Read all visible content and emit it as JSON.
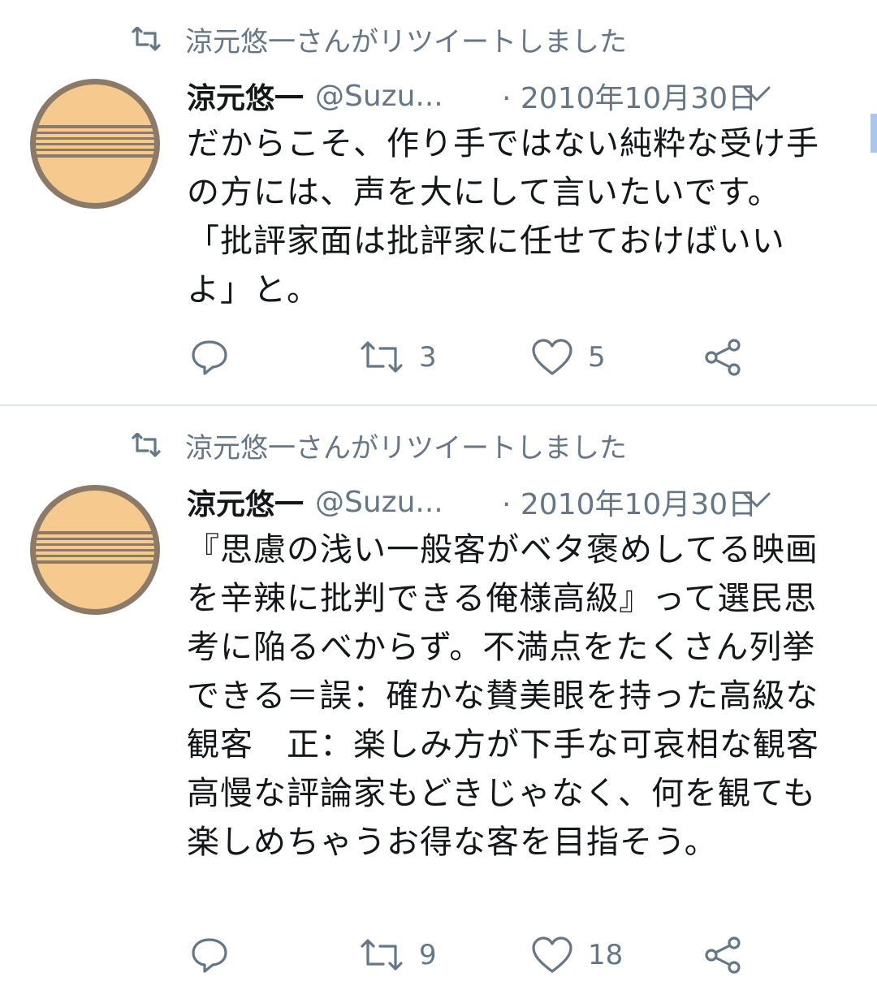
{
  "tweets": [
    {
      "retweet_label": "涼元悠一さんがリツイートしました",
      "author_name": "涼元悠一",
      "handle": "@Suzu...",
      "timestamp": "· 2010年10月30日",
      "text": "だからこそ、作り手ではない純粋な受け手の方には、声を大にして言いたいです。「批評家面は批評家に任せておけばいいよ」と。",
      "retweet_count": "3",
      "like_count": "5",
      "icons": [
        "retweet-icon",
        "avatar",
        "chevron-down-icon",
        "reply-icon",
        "retweet-icon",
        "heart-icon",
        "share-icon"
      ]
    },
    {
      "retweet_label": "涼元悠一さんがリツイートしました",
      "author_name": "涼元悠一",
      "handle": "@Suzu...",
      "timestamp": "· 2010年10月30日",
      "text": "『思慮の浅い一般客がベタ褒めしてる映画を辛辣に批判できる俺様高級』って選民思考に陥るべからず。不満点をたくさん列挙できる＝誤：確かな賛美眼を持った高級な観客　正：楽しみ方が下手な可哀相な観客　高慢な評論家もどきじゃなく、何を観ても楽しめちゃうお得な客を目指そう。",
      "retweet_count": "9",
      "like_count": "18",
      "icons": [
        "retweet-icon",
        "avatar",
        "chevron-down-icon",
        "reply-icon",
        "retweet-icon",
        "heart-icon",
        "share-icon"
      ]
    }
  ],
  "colors": {
    "text_primary": "#14171a",
    "text_secondary": "#657786",
    "divider": "#e1e8ed",
    "avatar_fill": "#f6c98f",
    "avatar_rim": "#8b7a68",
    "scroll_indicator": "#a9c7ea"
  }
}
